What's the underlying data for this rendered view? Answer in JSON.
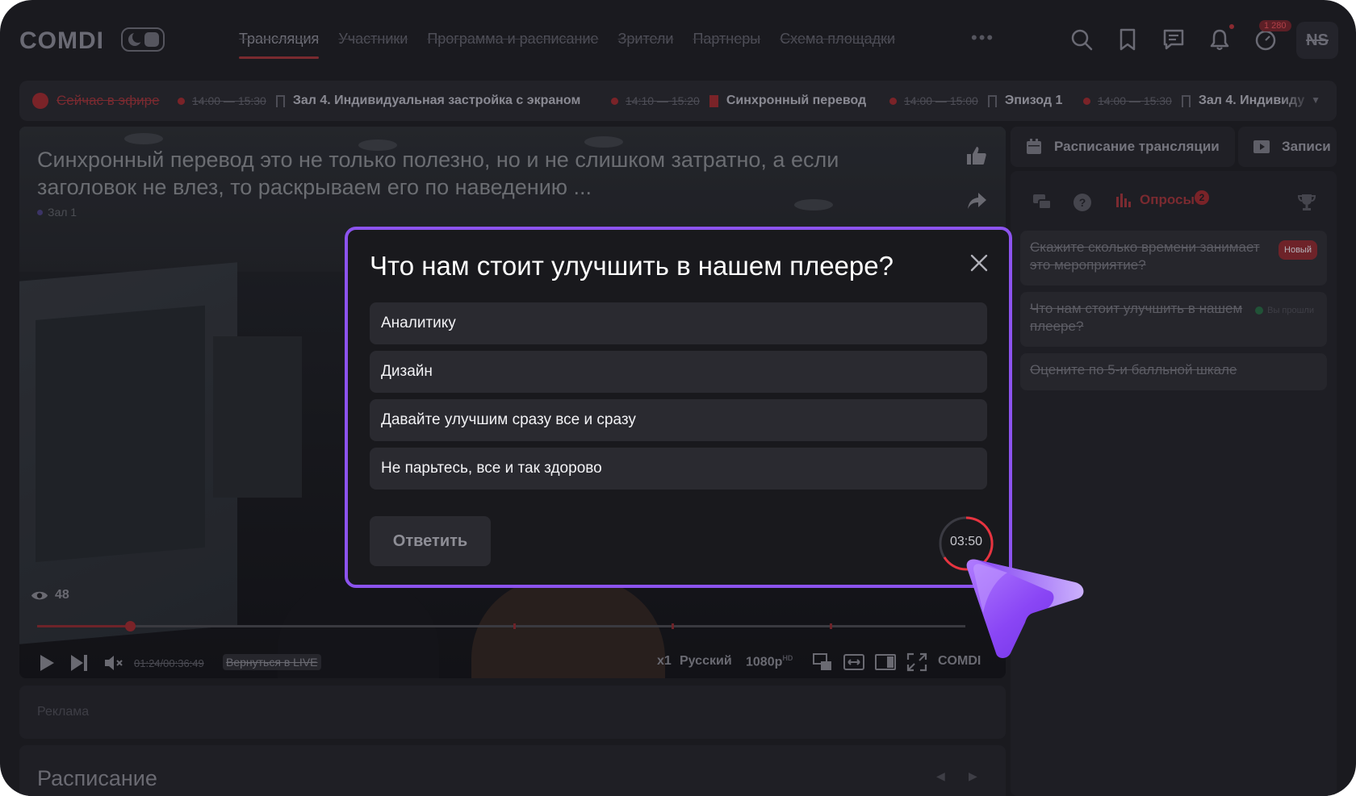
{
  "header": {
    "logo": "COMDI",
    "nav": [
      "Трансляция",
      "Участники",
      "Программа и расписание",
      "Зрители",
      "Партнеры",
      "Схема площадки"
    ],
    "nav_more": "•••",
    "counter_badge": "1 280",
    "avatar_initials": "NS"
  },
  "ticker": {
    "live_label": "Сейчас в эфире",
    "items": [
      {
        "time": "14:00 — 15:30",
        "name": "Зал 4. Индивидуальная застройка с экраном",
        "bookmarked": false
      },
      {
        "time": "14:10 — 15:20",
        "name": "Синхронный перевод",
        "bookmarked": true
      },
      {
        "time": "14:00 — 15:00",
        "name": "Эпизод 1",
        "bookmarked": false
      },
      {
        "time": "14:00 — 15:30",
        "name": "Зал 4. Индивиду",
        "bookmarked": false
      }
    ]
  },
  "video": {
    "title": "Синхронный перевод это не только полезно, но и не слишком затратно, а если заголовок не влез, то раскрываем его по наведению ...",
    "room": "Зал 1",
    "viewers": "48",
    "time": "01:24/00:36:49",
    "back_live": "Вернуться в LIVE",
    "speed": "x1",
    "language": "Русский",
    "quality": "1080p",
    "quality_badge": "HD",
    "brand": "COMDI",
    "progress": 0.1
  },
  "ad_label": "Реклама",
  "schedule_title": "Расписание",
  "right_panel": {
    "tab_schedule": "Расписание трансляции",
    "tab_records": "Записи",
    "polls_tab": "Опросы",
    "polls_count": "2",
    "polls": [
      {
        "text": "Скажите сколько времени занимает это мероприятие?",
        "status": "Новый"
      },
      {
        "text": "Что нам стоит улучшить в нашем плеере?",
        "status": "Вы прошли"
      },
      {
        "text": "Оцените по 5-и балльной шкале",
        "status": ""
      }
    ]
  },
  "modal": {
    "question": "Что нам стоит улучшить в нашем плеере?",
    "options": [
      "Аналитику",
      "Дизайн",
      "Давайте улучшим сразу все и сразу",
      "Не парьтесь, все и так здорово"
    ],
    "submit": "Ответить",
    "timer": "03:50"
  },
  "colors": {
    "accent": "#8c53ee",
    "red": "#e8333f",
    "background": "#1a1a1f"
  }
}
